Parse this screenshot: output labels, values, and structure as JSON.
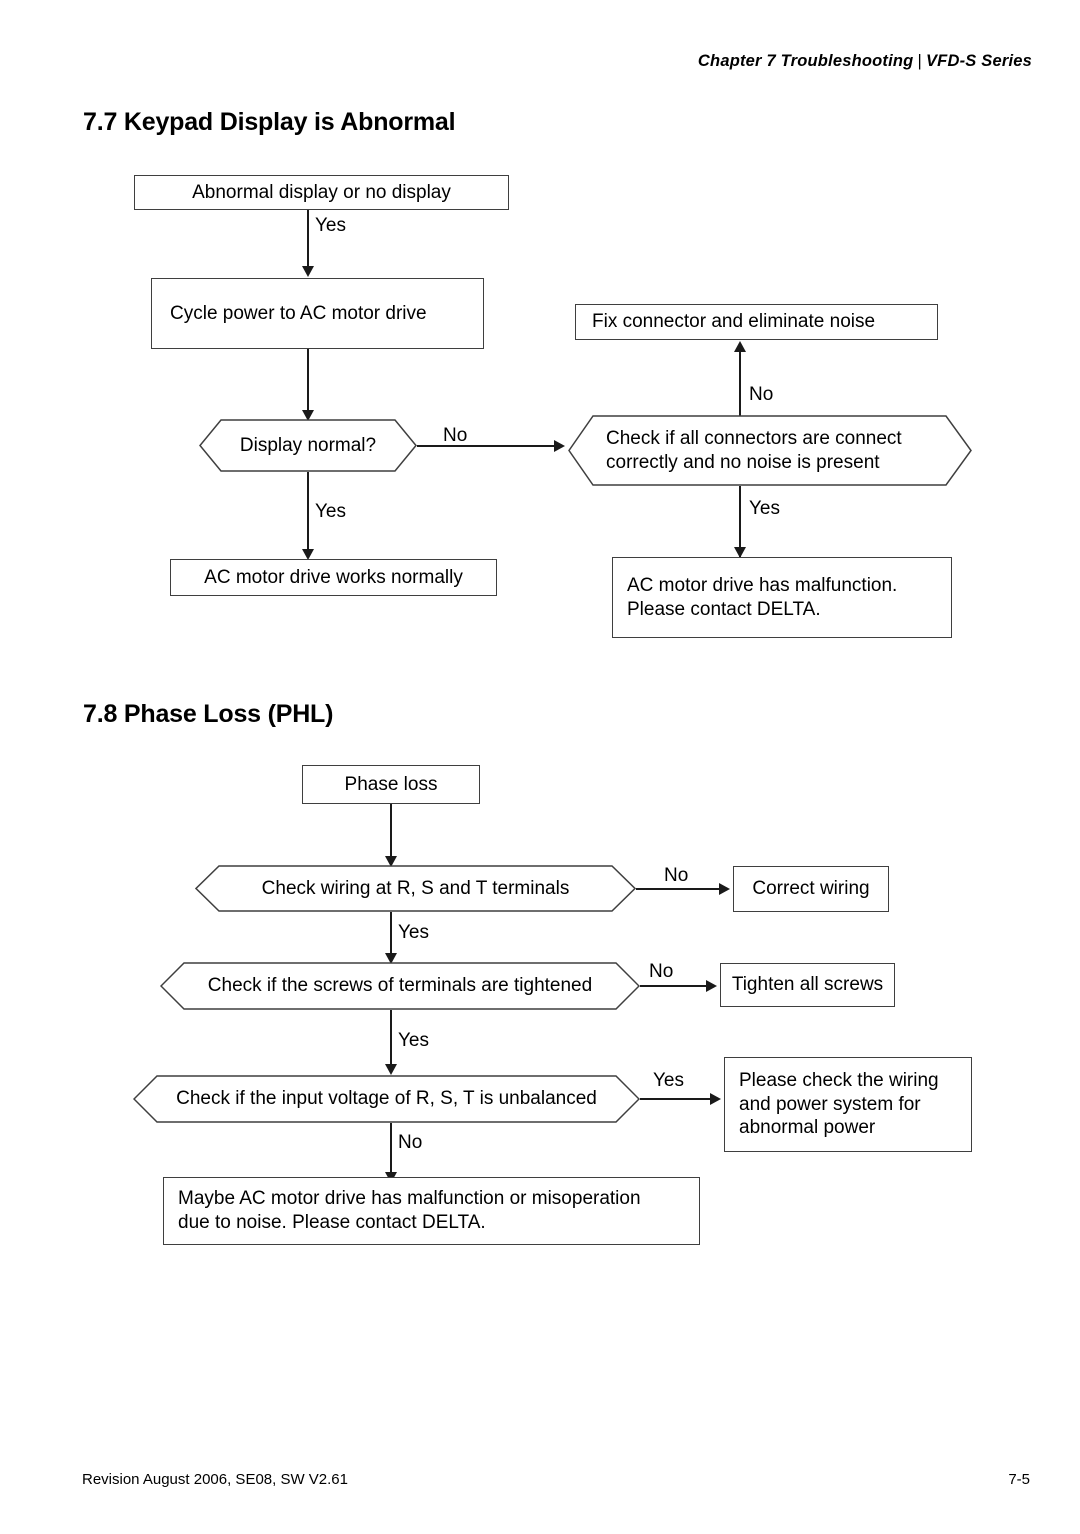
{
  "header": {
    "chapter": "Chapter 7  Troubleshooting",
    "separator": "|",
    "series": "VFD-S Series"
  },
  "footer": {
    "revision": "Revision August 2006, SE08, SW V2.61",
    "page_number": "7-5"
  },
  "sections": [
    {
      "number": "7.7",
      "title": "7.7 Keypad Display is Abnormal"
    },
    {
      "number": "7.8",
      "title": "7.8 Phase Loss (PHL)"
    }
  ],
  "flowchart_keypad": {
    "nodes": {
      "start": "Abnormal display or no display",
      "cycle_power": "Cycle power to AC motor drive",
      "display_normal": "Display normal?",
      "works_normally": "AC motor drive works normally",
      "check_connectors": "Check if all connectors are connect\ncorrectly and no noise is present",
      "fix_connector": "Fix connector and eliminate noise",
      "malfunction": "AC motor drive has malfunction.\nPlease contact DELTA."
    },
    "edges": {
      "start_yes": "Yes",
      "display_no": "No",
      "display_yes": "Yes",
      "connectors_no": "No",
      "connectors_yes": "Yes"
    }
  },
  "flowchart_phase_loss": {
    "nodes": {
      "start": "Phase loss",
      "check_wiring": "Check wiring at R, S and T terminals",
      "correct_wiring": "Correct wiring",
      "check_screws": "Check if the screws of terminals are tightened",
      "tighten_screws": "Tighten all screws",
      "check_voltage": "Check if the input voltage of R, S, T is unbalanced",
      "check_power": "Please check the wiring\nand power system for\nabnormal power",
      "maybe_malfunction": "Maybe AC motor drive has malfunction or misoperation\ndue to noise. Please contact DELTA."
    },
    "edges": {
      "wiring_no": "No",
      "wiring_yes": "Yes",
      "screws_no": "No",
      "screws_yes": "Yes",
      "voltage_yes": "Yes",
      "voltage_no": "No"
    }
  },
  "colors": {
    "ink": "#000000",
    "stroke": "#3f3f3f",
    "page_background": "#ffffff"
  }
}
